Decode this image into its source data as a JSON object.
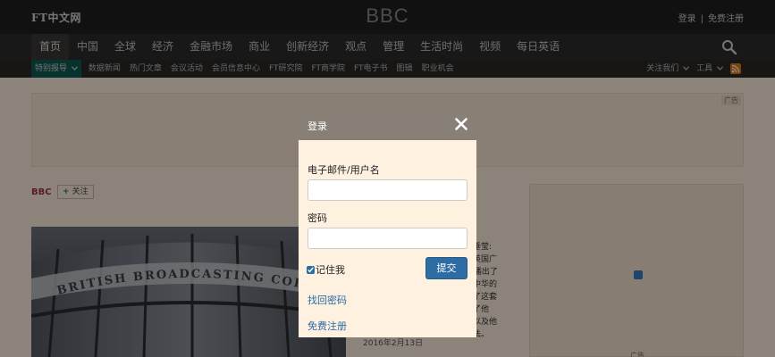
{
  "header": {
    "logo": "FT中文网",
    "title": "BBC",
    "login_label": "登录",
    "separator": "|",
    "register_label": "免费注册"
  },
  "nav": {
    "items": [
      "首页",
      "中国",
      "全球",
      "经济",
      "金融市场",
      "商业",
      "创新经济",
      "观点",
      "管理",
      "生活时尚",
      "视频",
      "每日英语"
    ],
    "active_index": 0
  },
  "subnav": {
    "special": "特别报导",
    "items": [
      "数据新闻",
      "热门文章",
      "会议活动",
      "会员信息中心",
      "FT研究院",
      "FT商学院",
      "FT电子书",
      "图辑",
      "职业机会"
    ],
    "right": [
      "关注我们",
      "工具"
    ]
  },
  "page": {
    "ad_label": "广告",
    "tag": "BBC",
    "follow_label": "关注",
    "excerpt_lines": [
      "人垂莹:",
      "、英国广",
      "C)播出了",
      "《中华的",
      "访了这套",
      "谈了他",
      "程以及他",
      "看法。"
    ],
    "date": "2016年2月13日",
    "side_ad_label": "广告",
    "hero_img_text": "BRITISH BROADCASTING CORPORATION"
  },
  "modal": {
    "title": "登录",
    "email_label": "电子邮件/用户名",
    "email_value": "",
    "password_label": "密码",
    "password_value": "",
    "remember_label": "记住我",
    "remember_checked": true,
    "submit_label": "提交",
    "forgot_label": "找回密码",
    "register_label": "免费注册"
  },
  "colors": {
    "topbar": "#1f1f1f",
    "navbar": "#2e2d2c",
    "page_bg": "#fff1e0",
    "modal_header": "#888077",
    "submit": "#2e6da4",
    "link": "#2a6aa8",
    "special_tag": "#0f5c54",
    "bbc_tag": "#9e2f50",
    "rss": "#e07a1b"
  },
  "icons": {
    "search": "search-icon",
    "close": "close-icon",
    "rss": "rss-icon",
    "chevron": "chevron-down-icon",
    "plus": "plus-icon"
  }
}
